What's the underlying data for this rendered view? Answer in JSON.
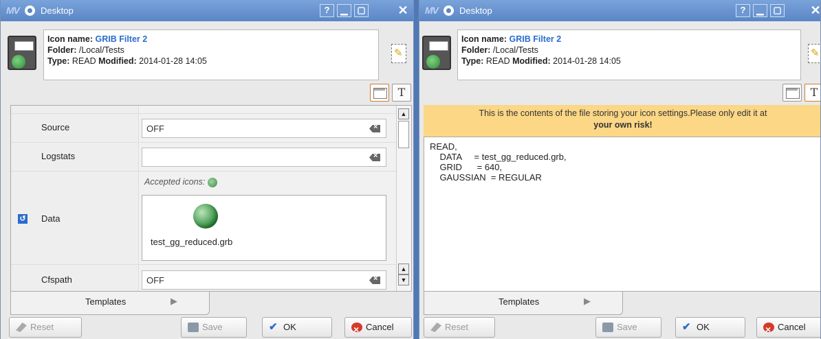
{
  "window": {
    "title": "Desktop",
    "help_label": "?",
    "close_label": "✕"
  },
  "info": {
    "name_label": "Icon name:",
    "name_value": "GRIB Filter 2",
    "folder_label": "Folder:",
    "folder_value": "/Local/Tests",
    "type_label": "Type:",
    "type_value": "READ",
    "modified_label": "Modified:",
    "modified_value": "2014-01-28 14:05"
  },
  "view_toggle": {
    "text_label": "T"
  },
  "properties": [
    {
      "label": "Source",
      "value": "OFF"
    },
    {
      "label": "Logstats",
      "value": ""
    },
    {
      "label": "Data",
      "accepted_label": "Accepted icons:",
      "file": "test_gg_reduced.grb"
    },
    {
      "label": "Cfspath",
      "value": "OFF"
    }
  ],
  "editor": {
    "warning_line1": "This is the contents of the file storing your icon settings.Please only edit it at",
    "warning_line2": "your own risk!",
    "content": "READ,\n    DATA     = test_gg_reduced.grb,\n    GRID      = 640,\n    GAUSSIAN  = REGULAR"
  },
  "tabs": {
    "templates_label": "Templates",
    "arrow": "▶"
  },
  "buttons": {
    "reset": "Reset",
    "save": "Save",
    "ok": "OK",
    "cancel": "Cancel"
  },
  "colors": {
    "accent": "#2a6ccd",
    "titlebar": "#5a86c6",
    "warning_bg": "#fbd786"
  }
}
